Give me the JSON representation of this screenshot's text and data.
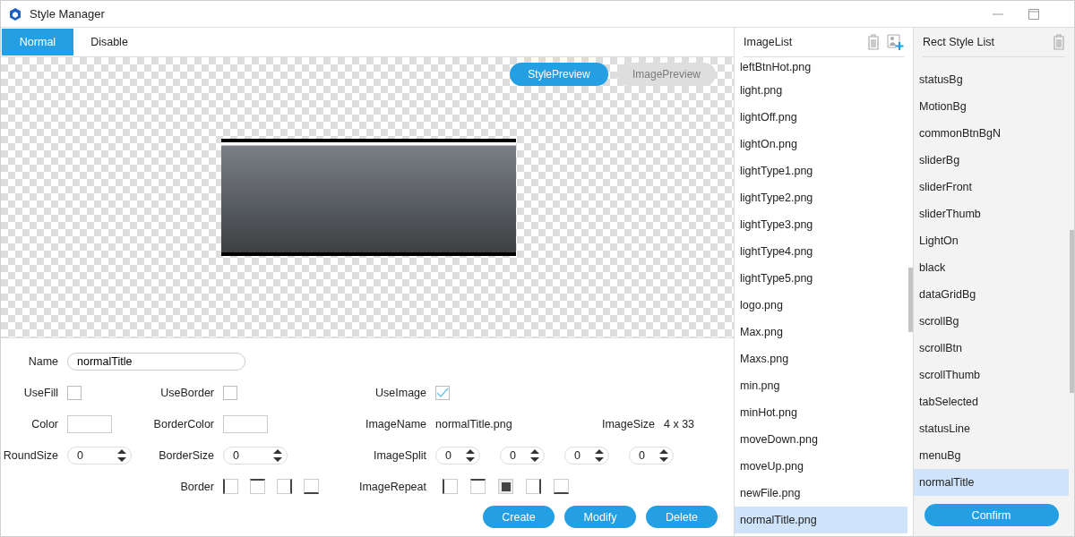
{
  "window": {
    "title": "Style Manager"
  },
  "tabs": [
    {
      "label": "Normal",
      "selected": true
    },
    {
      "label": "Disable",
      "selected": false
    }
  ],
  "preview_buttons": [
    {
      "label": "StylePreview",
      "selected": true
    },
    {
      "label": "ImagePreview",
      "selected": false
    }
  ],
  "form": {
    "name": {
      "label": "Name",
      "value": "normalTitle"
    },
    "use_fill": {
      "label": "UseFill",
      "checked": false
    },
    "use_border": {
      "label": "UseBorder",
      "checked": false
    },
    "use_image": {
      "label": "UseImage",
      "checked": true
    },
    "color": {
      "label": "Color"
    },
    "border_color": {
      "label": "BorderColor"
    },
    "image_name": {
      "label": "ImageName",
      "value": "normalTitle.png"
    },
    "image_size": {
      "label": "ImageSize",
      "value": "4 x 33"
    },
    "round_size": {
      "label": "RoundSize",
      "value": "0"
    },
    "border_size": {
      "label": "BorderSize",
      "value": "0"
    },
    "image_split": {
      "label": "ImageSplit",
      "values": [
        "0",
        "0",
        "0",
        "0"
      ]
    },
    "border": {
      "label": "Border",
      "toggles": [
        {
          "kind": "left",
          "selected": false
        },
        {
          "kind": "top",
          "selected": false
        },
        {
          "kind": "right",
          "selected": false
        },
        {
          "kind": "bottom",
          "selected": false
        }
      ]
    },
    "image_repeat": {
      "label": "ImageRepeat",
      "toggles": [
        {
          "kind": "left",
          "selected": false
        },
        {
          "kind": "top",
          "selected": false
        },
        {
          "kind": "center",
          "selected": true
        },
        {
          "kind": "right",
          "selected": false
        },
        {
          "kind": "bottom",
          "selected": false
        }
      ]
    },
    "buttons": [
      "Create",
      "Modify",
      "Delete"
    ]
  },
  "image_list": {
    "title": "ImageList",
    "items": [
      {
        "label": "leftBtnHot.png",
        "selected": false
      },
      {
        "label": "light.png",
        "selected": false
      },
      {
        "label": "lightOff.png",
        "selected": false
      },
      {
        "label": "lightOn.png",
        "selected": false
      },
      {
        "label": "lightType1.png",
        "selected": false
      },
      {
        "label": "lightType2.png",
        "selected": false
      },
      {
        "label": "lightType3.png",
        "selected": false
      },
      {
        "label": "lightType4.png",
        "selected": false
      },
      {
        "label": "lightType5.png",
        "selected": false
      },
      {
        "label": "logo.png",
        "selected": false
      },
      {
        "label": "Max.png",
        "selected": false
      },
      {
        "label": "Maxs.png",
        "selected": false
      },
      {
        "label": "min.png",
        "selected": false
      },
      {
        "label": "minHot.png",
        "selected": false
      },
      {
        "label": "moveDown.png",
        "selected": false
      },
      {
        "label": "moveUp.png",
        "selected": false
      },
      {
        "label": "newFile.png",
        "selected": false
      },
      {
        "label": "normalTitle.png",
        "selected": true
      }
    ]
  },
  "rect_style_list": {
    "title": "Rect Style List",
    "items": [
      {
        "label": "statusBg",
        "selected": false
      },
      {
        "label": "MotionBg",
        "selected": false
      },
      {
        "label": "commonBtnBgN",
        "selected": false
      },
      {
        "label": "sliderBg",
        "selected": false
      },
      {
        "label": "sliderFront",
        "selected": false
      },
      {
        "label": "sliderThumb",
        "selected": false
      },
      {
        "label": "LightOn",
        "selected": false
      },
      {
        "label": "black",
        "selected": false
      },
      {
        "label": "dataGridBg",
        "selected": false
      },
      {
        "label": "scrollBg",
        "selected": false
      },
      {
        "label": "scrollBtn",
        "selected": false
      },
      {
        "label": "scrollThumb",
        "selected": false
      },
      {
        "label": "tabSelected",
        "selected": false
      },
      {
        "label": "statusLine",
        "selected": false
      },
      {
        "label": "menuBg",
        "selected": false
      },
      {
        "label": "normalTitle",
        "selected": true
      }
    ],
    "confirm": "Confirm"
  }
}
